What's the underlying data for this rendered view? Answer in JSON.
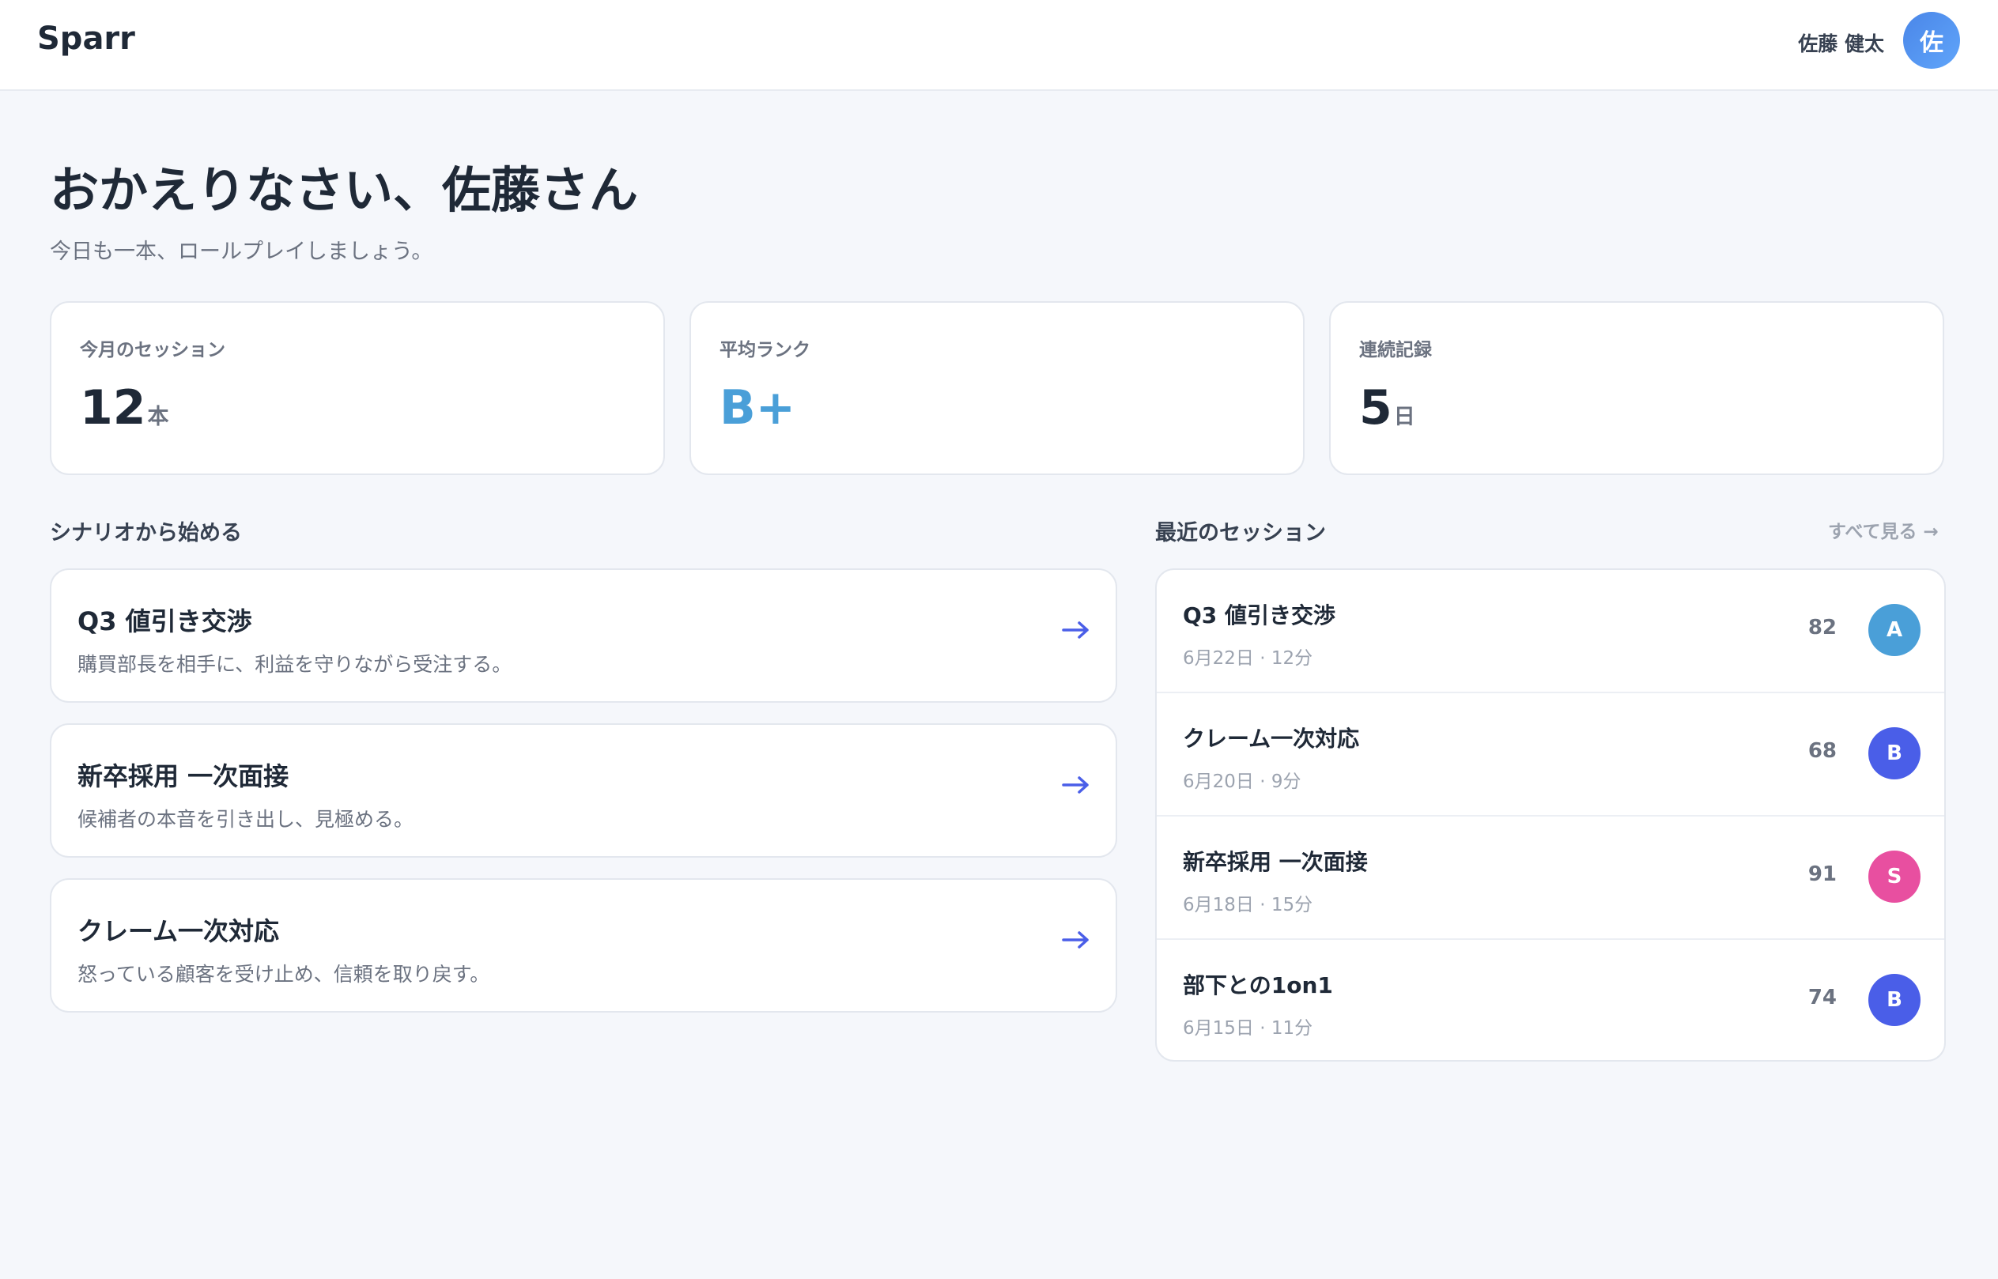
{
  "header": {
    "logo": "Sparr",
    "user_name": "佐藤 健太",
    "user_avatar_initial": "佐"
  },
  "welcome": {
    "title": "おかえりなさい、佐藤さん",
    "subtitle": "今日も一本、ロールプレイしましょう。"
  },
  "stats": [
    {
      "label": "今月のセッション",
      "value": "12",
      "unit": "本"
    },
    {
      "label": "平均ランク",
      "value": "B+",
      "unit": ""
    },
    {
      "label": "連続記録",
      "value": "5",
      "unit": "日"
    }
  ],
  "scenarios": {
    "heading": "シナリオから始める",
    "items": [
      {
        "title": "Q3 値引き交渉",
        "description": "購買部長を相手に、利益を守りながら受注する。"
      },
      {
        "title": "新卒採用 一次面接",
        "description": "候補者の本音を引き出し、見極める。"
      },
      {
        "title": "クレーム一次対応",
        "description": "怒っている顧客を受け止め、信頼を取り戻す。"
      }
    ]
  },
  "recent_sessions": {
    "heading": "最近のセッション",
    "see_all": "すべて見る →",
    "items": [
      {
        "title": "Q3 値引き交渉",
        "meta": "6月22日 · 12分",
        "score": "82",
        "avatar": "A",
        "avatar_color": "#4a9fd8"
      },
      {
        "title": "クレーム一次対応",
        "meta": "6月20日 · 9分",
        "score": "68",
        "avatar": "B",
        "avatar_color": "#4a5ee8"
      },
      {
        "title": "新卒採用 一次面接",
        "meta": "6月18日 · 15分",
        "score": "91",
        "avatar": "S",
        "avatar_color": "#e84fa0"
      },
      {
        "title": "部下との1on1",
        "meta": "6月15日 · 11分",
        "score": "74",
        "avatar": "B",
        "avatar_color": "#4a5ee8"
      }
    ]
  },
  "colors": {
    "accent_blue": "#4a9fd8",
    "arrow_indigo": "#4a5ee8"
  }
}
